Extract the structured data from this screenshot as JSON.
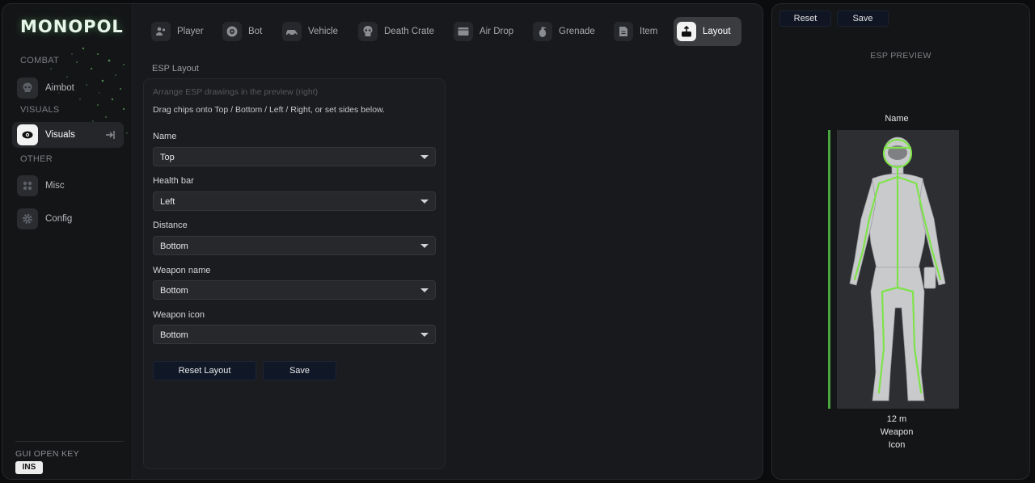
{
  "app": {
    "title": "MONOPOL"
  },
  "sidebar": {
    "sections": {
      "combat": "COMBAT",
      "visuals": "VISUALS",
      "other": "OTHER"
    },
    "items": [
      {
        "label": "Aimbot",
        "icon": "skull-icon"
      },
      {
        "label": "Visuals",
        "icon": "eye-icon",
        "active": true
      },
      {
        "label": "Misc",
        "icon": "grid-icon"
      },
      {
        "label": "Config",
        "icon": "gear-icon"
      }
    ],
    "gui_key": {
      "label": "GUI OPEN KEY",
      "value": "INS"
    }
  },
  "tabs": [
    {
      "label": "Player",
      "icon": "player-icon"
    },
    {
      "label": "Bot",
      "icon": "bot-eye-icon"
    },
    {
      "label": "Vehicle",
      "icon": "car-icon"
    },
    {
      "label": "Death Crate",
      "icon": "skull-icon"
    },
    {
      "label": "Air Drop",
      "icon": "crate-icon"
    },
    {
      "label": "Grenade",
      "icon": "grenade-icon"
    },
    {
      "label": "Item",
      "icon": "item-icon"
    },
    {
      "label": "Layout",
      "icon": "layout-icon",
      "active": true
    }
  ],
  "esp_layout": {
    "title": "ESP Layout",
    "hint_placeholder": "Arrange ESP drawings in the preview (right)",
    "hint": "Drag chips onto Top / Bottom / Left / Right, or set sides below.",
    "fields": [
      {
        "label": "Name",
        "value": "Top"
      },
      {
        "label": "Health bar",
        "value": "Left"
      },
      {
        "label": "Distance",
        "value": "Bottom"
      },
      {
        "label": "Weapon name",
        "value": "Bottom"
      },
      {
        "label": "Weapon icon",
        "value": "Bottom"
      }
    ],
    "reset_label": "Reset Layout",
    "save_label": "Save"
  },
  "preview": {
    "reset_label": "Reset",
    "save_label": "Save",
    "title": "ESP PREVIEW",
    "name": "Name",
    "distance": "12 m",
    "weapon": "Weapon",
    "icon": "Icon",
    "skeleton_color": "#7ee34a",
    "healthbar_color": "#4aa63f"
  },
  "colors": {
    "accent": "#7ee34a",
    "button_bg": "#101827"
  }
}
